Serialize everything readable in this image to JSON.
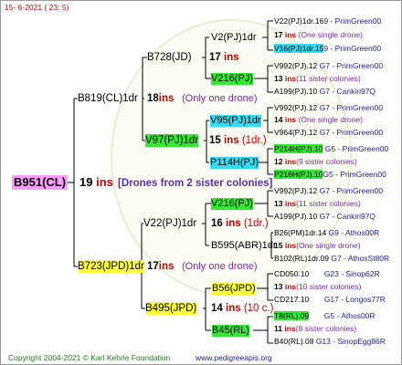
{
  "header": {
    "date": "15-  6-2021 (  23:  5)",
    "footer_copyright": "Copyright 2004-2021 © Karl Kehrle Foundation",
    "footer_url": "www.pedigreeapis.org"
  },
  "colors": {
    "accent_red": "#cc0000",
    "accent_blue": "#1a1aa8",
    "accent_purple": "#7a2aa0",
    "highlight_green": "#33e833",
    "highlight_cyan": "#33dcf0",
    "highlight_yellow": "#ffff33",
    "highlight_pink": "#ff9cff"
  },
  "root": {
    "id": "B951(CL)",
    "ins": "19",
    "ins_word": "ins",
    "note": "[Drones from 2 sister colonies]"
  },
  "gen1": [
    {
      "id": "B819(CL)1dr",
      "ins": "18",
      "ins_word": "ins",
      "note": "(Only one drone)"
    },
    {
      "id": "B723(JPD)1dr",
      "ins": "17",
      "ins_word": "ins",
      "note": "(Only one drone)"
    }
  ],
  "gen2": [
    {
      "id": "B728(JD)",
      "ins": "17",
      "ins_word": "ins",
      "note": ""
    },
    {
      "id": "V97(PJ)1dr",
      "ins": "15",
      "ins_word": "ins",
      "note": "(1dr.)"
    },
    {
      "id": "V22(PJ)1dr",
      "ins": "16",
      "ins_word": "ins",
      "note": "(1dr.)"
    },
    {
      "id": "B495(JPD)",
      "ins": "14",
      "ins_word": "ins",
      "note": "(10 c.)"
    }
  ],
  "gen3": [
    {
      "id": "V2(PJ)1dr",
      "ins": "",
      "ins_word": "",
      "note": ""
    },
    {
      "id": "V216(PJ)",
      "ins": "",
      "ins_word": "",
      "note": ""
    },
    {
      "id": "V95(PJ)1dr",
      "ins": "",
      "ins_word": "",
      "note": ""
    },
    {
      "id": "P114H(PJ)",
      "ins": "",
      "ins_word": "",
      "note": ""
    },
    {
      "id": "V216(PJ)",
      "ins": "",
      "ins_word": "",
      "note": ""
    },
    {
      "id": "B595(ABR)1dr",
      "ins": "",
      "ins_word": "",
      "note": ""
    },
    {
      "id": "B56(JPD)",
      "ins": "",
      "ins_word": "",
      "note": ""
    },
    {
      "id": "B45(RL)",
      "ins": "",
      "ins_word": "",
      "note": ""
    }
  ],
  "gen4": [
    {
      "left": "V22(PJ)1dr.16",
      "right": "9 - PrimGreen00"
    },
    {
      "left": "17",
      "mid": "ins",
      "right": "(One single drone)"
    },
    {
      "left": "V16(PJ)1dr.15",
      "right": "9 - PrimGreen00"
    },
    {
      "left": "V992(PJ).12",
      "right": "G7 - PrimGreen00"
    },
    {
      "left": "13",
      "mid": "ins",
      "right": "(11 sister colonies)"
    },
    {
      "left": "A199(PJ).10",
      "right": "G7 - Cankiri97Q"
    },
    {
      "left": "V992(PJ).12",
      "right": "G7 - PrimGreen00"
    },
    {
      "left": "14",
      "mid": "ins",
      "right": "(One single drone)"
    },
    {
      "left": "V964(PJ).12",
      "right": "G7 - PrimGreen00"
    },
    {
      "left": "P214H(PJ).10",
      "right": "G5 - PrimGreen00"
    },
    {
      "left": "12",
      "mid": "ins",
      "right": "(9 sister colonies)"
    },
    {
      "left": "P216H(PJ).10",
      "right": "G5 - PrimGreen00"
    },
    {
      "left": "V992(PJ).12",
      "right": "G7 - PrimGreen00"
    },
    {
      "left": "13",
      "mid": "ins",
      "right": "(11 sister colonies)"
    },
    {
      "left": "A199(PJ).10",
      "right": "G7 - Cankiri97Q"
    },
    {
      "left": "B26(PM)1dr.14",
      "right": "G9 - Athos00R"
    },
    {
      "left": "15",
      "mid": "ins",
      "right": "(One single drone)"
    },
    {
      "left": "B102(RL)1dr.09",
      "right": "G7 - AthosSt80R"
    },
    {
      "left": "CD050.10",
      "right": "G23 - Sinop62R"
    },
    {
      "left": "13",
      "mid": "ins",
      "right": "(10 sister colonies)"
    },
    {
      "left": "CD217.10",
      "right": "G17 - Longos77R"
    },
    {
      "left": "T8(RL).09",
      "right": "G5 - Athos00R"
    },
    {
      "left": "11",
      "mid": "ins",
      "right": "(8 sister colonies)"
    },
    {
      "left": "B40(RL).08",
      "right": "G13 - SinopEgg86R"
    }
  ]
}
